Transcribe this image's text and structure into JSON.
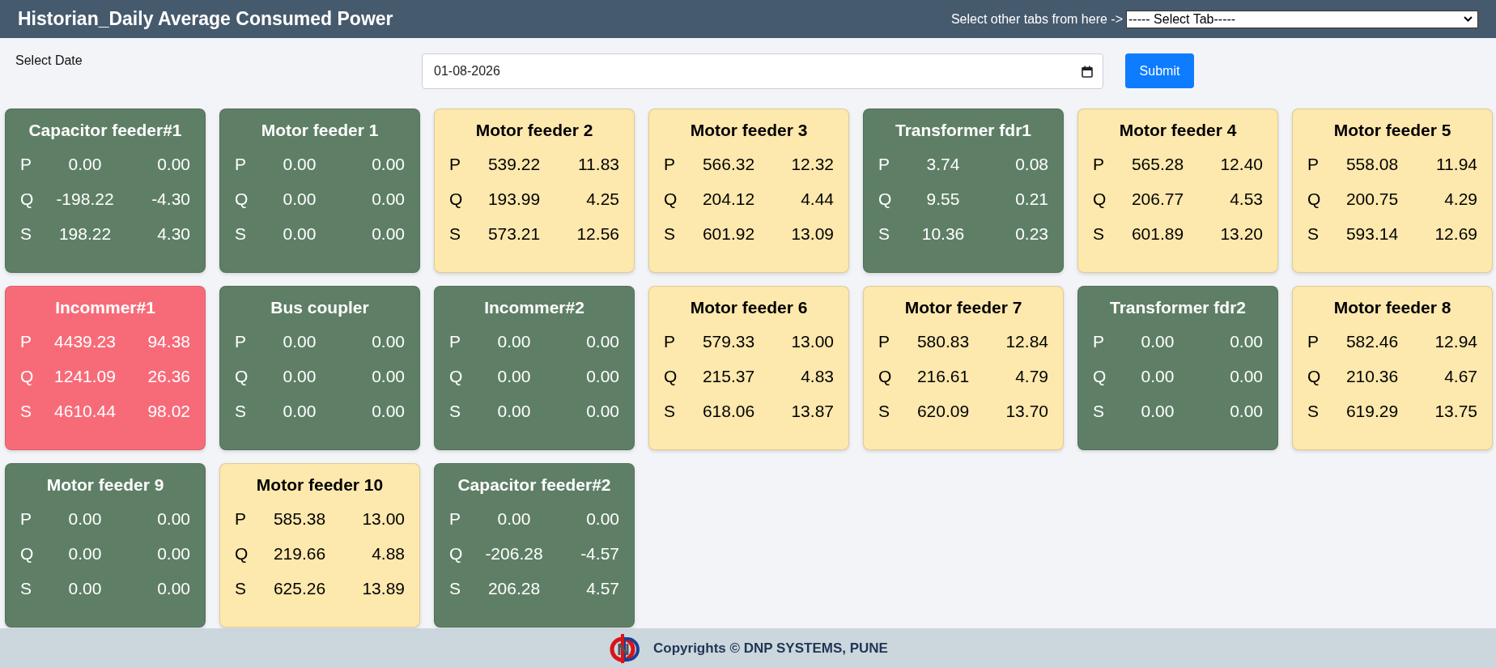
{
  "header": {
    "title": "Historian_Daily Average Consumed Power",
    "tab_hint": "Select other tabs from here ->",
    "tab_select": "----- Select Tab-----"
  },
  "date_form": {
    "label": "Select Date",
    "value": "01-08-2026",
    "submit": "Submit"
  },
  "cards": [
    {
      "title": "Capacitor feeder#1",
      "color": "#5e7f66",
      "rows": [
        [
          "P",
          "0.00",
          "0.00"
        ],
        [
          "Q",
          "-198.22",
          "-4.30"
        ],
        [
          "S",
          "198.22",
          "4.30"
        ]
      ]
    },
    {
      "title": "Motor feeder 1",
      "color": "#5e7f66",
      "rows": [
        [
          "P",
          "0.00",
          "0.00"
        ],
        [
          "Q",
          "0.00",
          "0.00"
        ],
        [
          "S",
          "0.00",
          "0.00"
        ]
      ]
    },
    {
      "title": "Motor feeder 2",
      "color": "#fde8ad",
      "rows": [
        [
          "P",
          "539.22",
          "11.83"
        ],
        [
          "Q",
          "193.99",
          "4.25"
        ],
        [
          "S",
          "573.21",
          "12.56"
        ]
      ]
    },
    {
      "title": "Motor feeder 3",
      "color": "#fde8ad",
      "rows": [
        [
          "P",
          "566.32",
          "12.32"
        ],
        [
          "Q",
          "204.12",
          "4.44"
        ],
        [
          "S",
          "601.92",
          "13.09"
        ]
      ]
    },
    {
      "title": "Transformer fdr1",
      "color": "#5e7f66",
      "rows": [
        [
          "P",
          "3.74",
          "0.08"
        ],
        [
          "Q",
          "9.55",
          "0.21"
        ],
        [
          "S",
          "10.36",
          "0.23"
        ]
      ]
    },
    {
      "title": "Motor feeder 4",
      "color": "#fde8ad",
      "rows": [
        [
          "P",
          "565.28",
          "12.40"
        ],
        [
          "Q",
          "206.77",
          "4.53"
        ],
        [
          "S",
          "601.89",
          "13.20"
        ]
      ]
    },
    {
      "title": "Motor feeder 5",
      "color": "#fde8ad",
      "rows": [
        [
          "P",
          "558.08",
          "11.94"
        ],
        [
          "Q",
          "200.75",
          "4.29"
        ],
        [
          "S",
          "593.14",
          "12.69"
        ]
      ]
    },
    {
      "title": "Incommer#1",
      "color": "#f76b79",
      "rows": [
        [
          "P",
          "4439.23",
          "94.38"
        ],
        [
          "Q",
          "1241.09",
          "26.36"
        ],
        [
          "S",
          "4610.44",
          "98.02"
        ]
      ]
    },
    {
      "title": "Bus coupler",
      "color": "#5e7f66",
      "rows": [
        [
          "P",
          "0.00",
          "0.00"
        ],
        [
          "Q",
          "0.00",
          "0.00"
        ],
        [
          "S",
          "0.00",
          "0.00"
        ]
      ]
    },
    {
      "title": "Incommer#2",
      "color": "#5e7f66",
      "rows": [
        [
          "P",
          "0.00",
          "0.00"
        ],
        [
          "Q",
          "0.00",
          "0.00"
        ],
        [
          "S",
          "0.00",
          "0.00"
        ]
      ]
    },
    {
      "title": "Motor feeder 6",
      "color": "#fde8ad",
      "rows": [
        [
          "P",
          "579.33",
          "13.00"
        ],
        [
          "Q",
          "215.37",
          "4.83"
        ],
        [
          "S",
          "618.06",
          "13.87"
        ]
      ]
    },
    {
      "title": "Motor feeder 7",
      "color": "#fde8ad",
      "rows": [
        [
          "P",
          "580.83",
          "12.84"
        ],
        [
          "Q",
          "216.61",
          "4.79"
        ],
        [
          "S",
          "620.09",
          "13.70"
        ]
      ]
    },
    {
      "title": "Transformer fdr2",
      "color": "#5e7f66",
      "rows": [
        [
          "P",
          "0.00",
          "0.00"
        ],
        [
          "Q",
          "0.00",
          "0.00"
        ],
        [
          "S",
          "0.00",
          "0.00"
        ]
      ]
    },
    {
      "title": "Motor feeder 8",
      "color": "#fde8ad",
      "rows": [
        [
          "P",
          "582.46",
          "12.94"
        ],
        [
          "Q",
          "210.36",
          "4.67"
        ],
        [
          "S",
          "619.29",
          "13.75"
        ]
      ]
    },
    {
      "title": "Motor feeder 9",
      "color": "#5e7f66",
      "rows": [
        [
          "P",
          "0.00",
          "0.00"
        ],
        [
          "Q",
          "0.00",
          "0.00"
        ],
        [
          "S",
          "0.00",
          "0.00"
        ]
      ]
    },
    {
      "title": "Motor feeder 10",
      "color": "#fde8ad",
      "rows": [
        [
          "P",
          "585.38",
          "13.00"
        ],
        [
          "Q",
          "219.66",
          "4.88"
        ],
        [
          "S",
          "625.26",
          "13.89"
        ]
      ]
    },
    {
      "title": "Capacitor feeder#2",
      "color": "#5e7f66",
      "rows": [
        [
          "P",
          "0.00",
          "0.00"
        ],
        [
          "Q",
          "-206.28",
          "-4.57"
        ],
        [
          "S",
          "206.28",
          "4.57"
        ]
      ]
    }
  ],
  "footer": {
    "text": "Copyrights © DNP SYSTEMS, PUNE"
  }
}
